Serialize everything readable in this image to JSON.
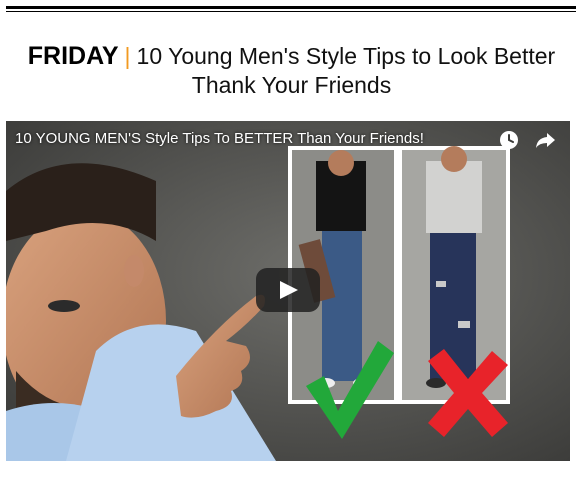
{
  "header": {
    "day": "FRIDAY",
    "separator": "|",
    "title_line1": "10 Young Men's Style Tips to Look Better",
    "title_line2": "Thank Your Friends"
  },
  "video": {
    "title": "10 YOUNG MEN'S Style Tips To BETTER Than Your Friends!",
    "icons": [
      "watch-later-icon",
      "share-icon",
      "play-icon",
      "check-icon",
      "cross-icon"
    ],
    "colors": {
      "check": "#22a83a",
      "cross": "#e8232a",
      "play_bg": "#212121"
    }
  }
}
